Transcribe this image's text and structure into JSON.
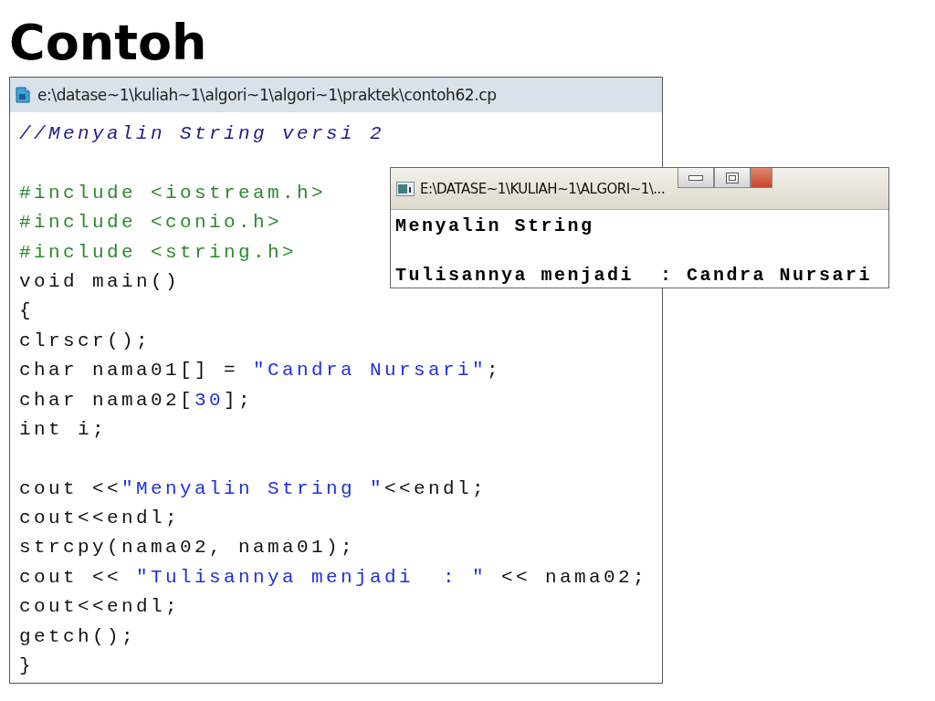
{
  "heading": "Contoh",
  "editor": {
    "title": "e:\\datase~1\\kuliah~1\\algori~1\\algori~1\\praktek\\contoh62.cp",
    "lines": [
      {
        "kind": "code",
        "tokens": [
          {
            "kind": "comment",
            "text": "//Menyalin String versi 2"
          }
        ]
      },
      {
        "kind": "blank"
      },
      {
        "kind": "code",
        "tokens": [
          {
            "kind": "preprocessor",
            "text": "#include <iostream.h>"
          }
        ]
      },
      {
        "kind": "code",
        "tokens": [
          {
            "kind": "preprocessor",
            "text": "#include <conio.h>"
          }
        ]
      },
      {
        "kind": "code",
        "tokens": [
          {
            "kind": "preprocessor",
            "text": "#include <string.h>"
          }
        ]
      },
      {
        "kind": "code",
        "tokens": [
          {
            "kind": "plain",
            "text": "void main()"
          }
        ]
      },
      {
        "kind": "code",
        "tokens": [
          {
            "kind": "plain",
            "text": "{"
          }
        ]
      },
      {
        "kind": "code",
        "tokens": [
          {
            "kind": "plain",
            "text": "clrscr();"
          }
        ]
      },
      {
        "kind": "code",
        "tokens": [
          {
            "kind": "plain",
            "text": "char nama01[] = "
          },
          {
            "kind": "string",
            "text": "\"Candra Nursari\""
          },
          {
            "kind": "plain",
            "text": ";"
          }
        ]
      },
      {
        "kind": "code",
        "tokens": [
          {
            "kind": "plain",
            "text": "char nama02["
          },
          {
            "kind": "number",
            "text": "30"
          },
          {
            "kind": "plain",
            "text": "];"
          }
        ]
      },
      {
        "kind": "code",
        "tokens": [
          {
            "kind": "plain",
            "text": "int i;"
          }
        ]
      },
      {
        "kind": "blank"
      },
      {
        "kind": "code",
        "tokens": [
          {
            "kind": "plain",
            "text": "cout <<"
          },
          {
            "kind": "string",
            "text": "\"Menyalin String \""
          },
          {
            "kind": "plain",
            "text": "<<endl;"
          }
        ]
      },
      {
        "kind": "code",
        "tokens": [
          {
            "kind": "plain",
            "text": "cout<<endl;"
          }
        ]
      },
      {
        "kind": "code",
        "tokens": [
          {
            "kind": "plain",
            "text": "strcpy(nama02, nama01);"
          }
        ]
      },
      {
        "kind": "code",
        "tokens": [
          {
            "kind": "plain",
            "text": "cout << "
          },
          {
            "kind": "string",
            "text": "\"Tulisannya menjadi  : \""
          },
          {
            "kind": "plain",
            "text": " << nama02;"
          }
        ]
      },
      {
        "kind": "code",
        "tokens": [
          {
            "kind": "plain",
            "text": "cout<<endl;"
          }
        ]
      },
      {
        "kind": "code",
        "tokens": [
          {
            "kind": "plain",
            "text": "getch();"
          }
        ]
      },
      {
        "kind": "code",
        "tokens": [
          {
            "kind": "plain",
            "text": "}"
          }
        ]
      }
    ]
  },
  "console": {
    "title": "E:\\DATASE~1\\KULIAH~1\\ALGORI~1\\...",
    "lines": [
      {
        "kind": "text",
        "text": "Menyalin String"
      },
      {
        "kind": "blank"
      },
      {
        "kind": "text",
        "text": "Tulisannya menjadi  : Candra Nursari"
      }
    ]
  }
}
